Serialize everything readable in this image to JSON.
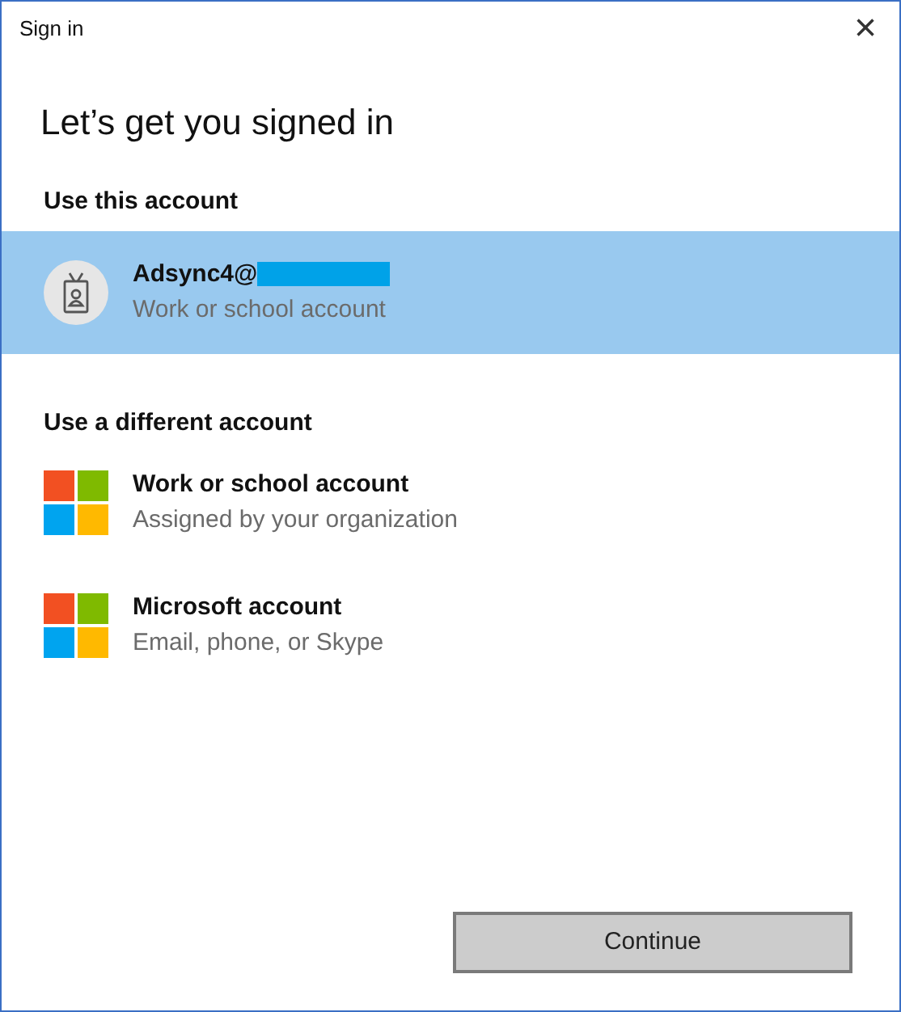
{
  "window": {
    "title": "Sign in",
    "close": "×"
  },
  "heading": "Let’s get you signed in",
  "current_section": {
    "title": "Use this account",
    "accounts": [
      {
        "name": "Adsync4@",
        "subtitle": "Work or school account",
        "selected": true,
        "kind": "badge"
      }
    ]
  },
  "other_section": {
    "title": "Use a different account",
    "accounts": [
      {
        "name": "Work or school account",
        "subtitle": "Assigned by your organization",
        "selected": false,
        "kind": "windows"
      },
      {
        "name": "Microsoft account",
        "subtitle": "Email, phone, or Skype",
        "selected": false,
        "kind": "windows"
      }
    ]
  },
  "continue_button": "Continue"
}
